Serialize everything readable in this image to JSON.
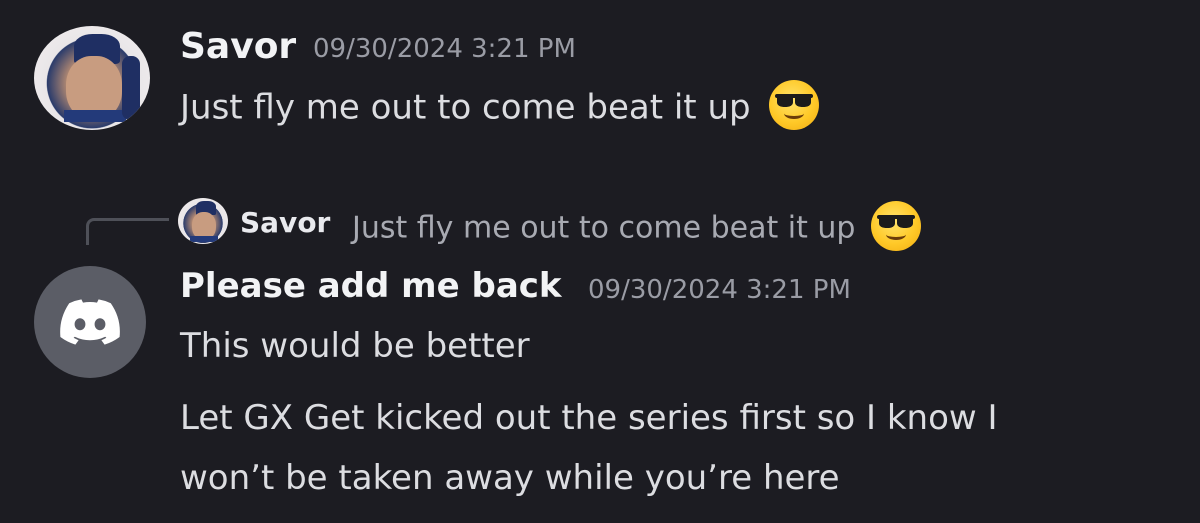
{
  "messages": [
    {
      "username": "Savor",
      "timestamp": "09/30/2024 3:21 PM",
      "text": "Just fly me out to come beat it up",
      "emoji": "smiling-face-with-sunglasses",
      "avatar": "user-photo-avatar"
    },
    {
      "reply": {
        "username": "Savor",
        "text": "Just fly me out to come beat it up",
        "emoji": "smiling-face-with-sunglasses"
      },
      "username": "Please add me back",
      "timestamp": "09/30/2024 3:21 PM",
      "avatar": "discord-default-avatar",
      "lines": [
        "This would be better",
        "Let GX Get kicked out the series first so I know I",
        "won’t be taken away while you’re here"
      ]
    }
  ],
  "colors": {
    "background": "#1c1c22",
    "username": "#f2f3f5",
    "timestamp": "#9a9ca5",
    "message": "#dcdde1",
    "reply_text": "#a8aab2",
    "default_avatar": "#5b5d66"
  }
}
